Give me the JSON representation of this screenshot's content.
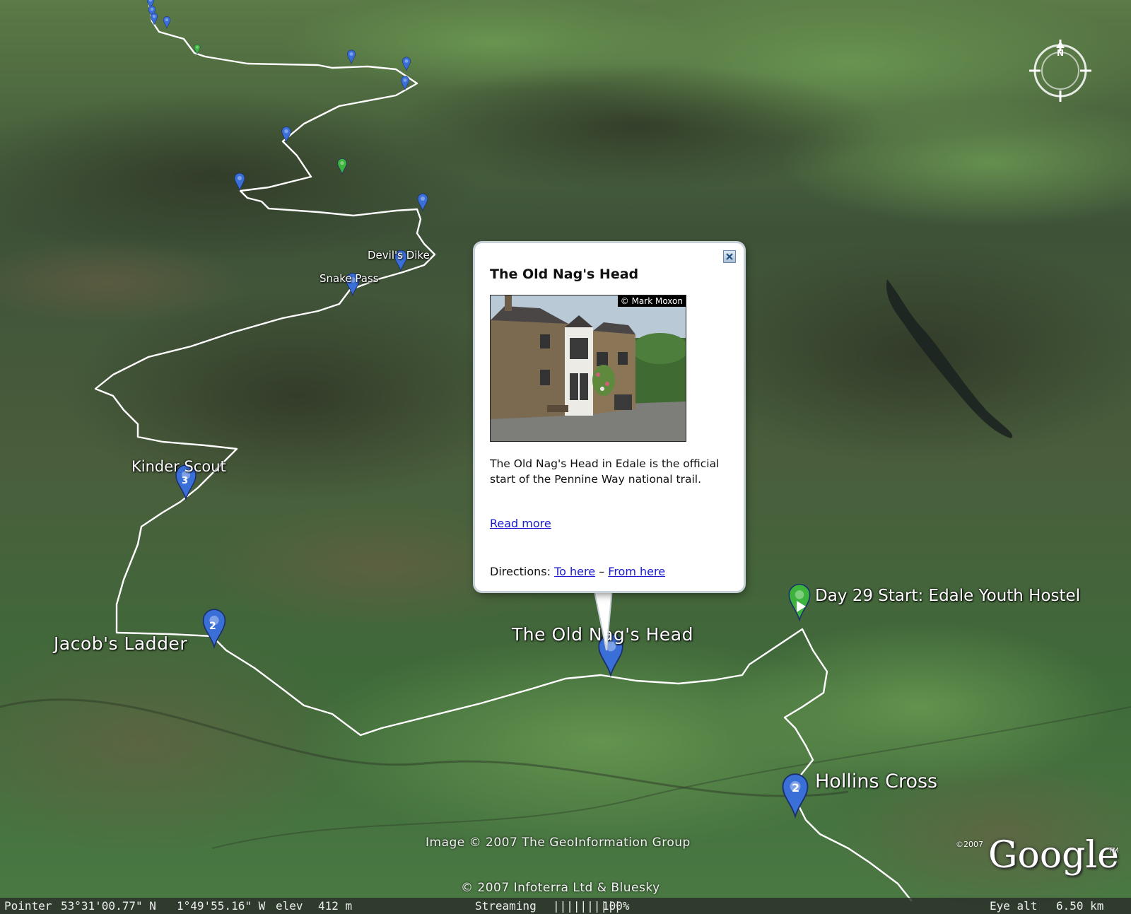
{
  "map_labels": {
    "devils_dike": "Devil's Dike",
    "snake_pass": "Snake Pass",
    "kinder_scout": "Kinder Scout",
    "jacobs_ladder": "Jacob's Ladder",
    "old_nags_head": "The Old Nag's Head",
    "day29_start": "Day 29 Start: Edale Youth Hostel",
    "hollins_cross": "Hollins Cross"
  },
  "pin_numbers": {
    "kinder_scout": "3",
    "jacobs_ladder": "2",
    "hollins_cross": "2"
  },
  "balloon": {
    "title": "The Old Nag's Head",
    "photo_credit": "© Mark Moxon",
    "description": "The Old Nag's Head in Edale is the official start of the Pennine Way national trail.",
    "read_more": "Read more",
    "directions_label": "Directions:",
    "to_here": "To here",
    "separator": "–",
    "from_here": "From here"
  },
  "credits": {
    "image": "Image © 2007 The GeoInformation Group",
    "infoterra": "© 2007 Infoterra Ltd & Bluesky",
    "google_copyright": "©2007",
    "google_logo": "Google",
    "google_tm": "TM"
  },
  "compass": {
    "north_letter": "N"
  },
  "status_bar": {
    "pointer_label": "Pointer",
    "latitude": "53°31'00.77\" N",
    "longitude": "1°49'55.16\" W",
    "elev_label": "elev",
    "elevation": "412 m",
    "streaming_label": "Streaming",
    "streaming_bar": "||||||||||",
    "streaming_percent": "100%",
    "eye_alt_label": "Eye alt",
    "eye_alt": "6.50 km"
  },
  "colors": {
    "pin_blue": "#3b6fd8",
    "pin_green": "#3cb33c",
    "trail": "#ffffff",
    "link": "#1a1acc"
  }
}
